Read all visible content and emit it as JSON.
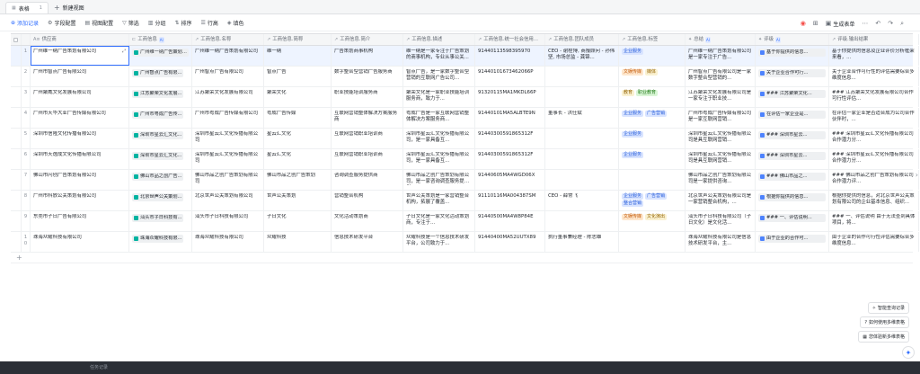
{
  "tabs": [
    {
      "label": "表格",
      "count": "1",
      "active": true
    },
    {
      "label": "新建视图",
      "active": false
    }
  ],
  "toolbar": {
    "add_record": "添加记录",
    "field_config": "字段配置",
    "view_config": "视图配置",
    "filter": "筛选",
    "group": "分组",
    "sort": "排序",
    "row_height": "行高",
    "fill_color": "填色",
    "generate_form": "生成表单"
  },
  "columns": [
    {
      "label": "供应商",
      "icon": "text-icon",
      "ai": false
    },
    {
      "label": "工商信息",
      "icon": "link-icon",
      "ai": true
    },
    {
      "label": "工商信息.名称",
      "icon": "lookup-icon",
      "ai": false
    },
    {
      "label": "工商信息.简称",
      "icon": "lookup-icon",
      "ai": false
    },
    {
      "label": "工商信息.简介",
      "icon": "lookup-icon",
      "ai": false
    },
    {
      "label": "工商信息.描述",
      "icon": "lookup-icon",
      "ai": false
    },
    {
      "label": "工商信息.统一社会信用...",
      "icon": "lookup-icon",
      "ai": false
    },
    {
      "label": "工商信息.团队成员",
      "icon": "lookup-icon",
      "ai": false
    },
    {
      "label": "工商信息.标签",
      "icon": "lookup-icon",
      "ai": false
    },
    {
      "label": "总结",
      "icon": "ai-icon",
      "ai": true
    },
    {
      "label": "评级",
      "icon": "ai-icon",
      "ai": true
    },
    {
      "label": "评级.输出结果",
      "icon": "lookup-icon",
      "ai": false
    }
  ],
  "rows": [
    {
      "num": "1",
      "supplier": "广州维一纳广告策划有限公司",
      "biz": "广州维一纳广告策划有...",
      "name": "广州维一纳广告策划有限公司",
      "short": "维一纳",
      "intro": "广告策划商事机构",
      "desc": "维一纳是一家专注于广告策划的商事机构，专业从事公关...",
      "credit": "91440113598395970",
      "team": "CEO - 谢程博, 商报顾问 - 孙伟坚, 市场总监 - 龚锦...",
      "tags": [
        {
          "t": "企业服务",
          "c": "blue"
        }
      ],
      "summary": "广州维一纳广告策划有限公司是一家专注于广告...",
      "rating": "基于你提供的信息...",
      "result": "基于你提供的信息及企业评价分析框架来看，..."
    },
    {
      "num": "2",
      "supplier": "广州市智点广告有限公司",
      "biz": "广州智点广告有限...",
      "name": "广州智点广告有限公司",
      "short": "智点广告",
      "intro": "数字整合型营销广告服务商",
      "desc": "智点广告，是一家数字整合型营销的互联网广告公司...",
      "credit": "91440101673462066P",
      "team": "",
      "tags": [
        {
          "t": "文娱传媒",
          "c": "orange"
        },
        {
          "t": "媒体",
          "c": "yellow"
        }
      ],
      "summary": "广州智点广告有限公司是一家数字整合型营销的...",
      "rating": "关于企业合作可行...",
      "result": "关于企业合作可行性的评估需要综合多维度信息..."
    },
    {
      "num": "3",
      "supplier": "广州聚威文化发展有限公司",
      "biz": "江苏聚荣文化发展...",
      "name": "江苏聚荣文化发展有限公司",
      "short": "聚荣文化",
      "intro": "职业技能培训服务商",
      "desc": "聚荣文化是一家职业技能培训服务商，致力于...",
      "credit": "91320115MA1MKDL66P",
      "team": "",
      "tags": [
        {
          "t": "教育",
          "c": "yellow"
        },
        {
          "t": "职业教育",
          "c": "green"
        }
      ],
      "summary": "江苏聚荣文化发展有限公司是一家专注于职业技...",
      "rating": "### 江苏聚荣文化...",
      "result": "### 江苏聚荣文化发展有限公司合作可行性评估..."
    },
    {
      "num": "4",
      "supplier": "广州市天华大业广告传媒有限公司",
      "biz": "广州市粤成广告传...",
      "name": "广州市粤成广告传媒有限公司",
      "short": "粤成广告传媒",
      "intro": "互联网营销整体解决方案服务商",
      "desc": "粤成广告是一家互联网营销整体解决方案服务商...",
      "credit": "91440101MA5ALBTE9N",
      "team": "董事长 - 洪仕斌",
      "tags": [
        {
          "t": "企业服务",
          "c": "blue"
        },
        {
          "t": "广告营销",
          "c": "blue"
        }
      ],
      "summary": "广州市粤成广告传媒有限公司是一家互联网营销...",
      "rating": "在评估一家企业是...",
      "result": "在评估一家企业是否适合成为公司合作伙伴时，..."
    },
    {
      "num": "5",
      "supplier": "深圳市信隆文化传播有限公司",
      "biz": "深圳市星云汇文化...",
      "name": "深圳市星云汇文化传播有限公司",
      "short": "星云汇文化",
      "intro": "互联网营销职业培训商",
      "desc": "深圳市星云汇文化传播有限公司，是一家具备互...",
      "credit": "91440300591865312F",
      "team": "",
      "tags": [
        {
          "t": "企业服务",
          "c": "blue"
        }
      ],
      "summary": "深圳市星云汇文化传播有限公司是具互联网营销...",
      "rating": "### 深圳市星云...",
      "result": "### 深圳市星云汇文化传播有限公司合作潜力分..."
    },
    {
      "num": "6",
      "supplier": "深圳市天逸成文化传播有限公司",
      "biz": "深圳市星云汇文化...",
      "name": "深圳市星云汇文化传播有限公司",
      "short": "星云汇文化",
      "intro": "互联网营销职业培训商",
      "desc": "深圳市星云汇文化传播有限公司，是一家具备互...",
      "credit": "91440300591865312F",
      "team": "",
      "tags": [
        {
          "t": "企业服务",
          "c": "blue"
        }
      ],
      "summary": "深圳市星云汇文化传播有限公司是具互联网营销...",
      "rating": "### 深圳市星云...",
      "result": "### 深圳市星云汇文化传播有限公司合作潜力分..."
    },
    {
      "num": "7",
      "supplier": "佛山市闪创广告策划有限公司",
      "biz": "佛山市品之创广告...",
      "name": "佛山市品之创广告策划有限公司",
      "short": "佛山市品之创广告策划",
      "intro": "咨询调查服务提供商",
      "desc": "佛山市品之创广告策划有限公司，是一家咨询调查服务提供...",
      "credit": "91440605MA4WGD06X",
      "team": "",
      "tags": [],
      "summary": "佛山市品之创广告策划有限公司是一家提供咨询...",
      "rating": "### 佛山市品之...",
      "result": "### 佛山市品之创广告策划有限公司合作潜力评..."
    },
    {
      "num": "8",
      "supplier": "广州市科放公关策划有限公司",
      "biz": "北京世声公关策划...",
      "name": "北京世声公关策划有限公司",
      "short": "世声公关策划",
      "intro": "营销整合机构",
      "desc": "世声公关策划是一家营销整合机构，拓展了覆盖...",
      "credit": "91110116MA004387SM",
      "team": "CEO - 薛常飞",
      "tags": [
        {
          "t": "企业服务",
          "c": "blue"
        },
        {
          "t": "广告营销",
          "c": "blue"
        },
        {
          "t": "整合营销",
          "c": "blue"
        }
      ],
      "summary": "北京世声公关策划有限公司是一家营销整合机构，...",
      "rating": "根据你提供的信息...",
      "result": "根据你提供的信息，对北京世声公关策划有限公司的企业基本信息、组织..."
    },
    {
      "num": "9",
      "supplier": "东莞市子日广告有限公司",
      "biz": "汕头市子日科技有...",
      "name": "汕头市子日科技有限公司",
      "short": "子日文化",
      "intro": "文化活动策划商",
      "desc": "子日文化是一家文化活动策划商，专注于...",
      "credit": "91440500MA4W8P84E",
      "team": "",
      "tags": [
        {
          "t": "文娱传媒",
          "c": "orange"
        },
        {
          "t": "文化演出",
          "c": "yellow"
        }
      ],
      "summary": "汕头市子日科技有限公司（子日文化）是文化活...",
      "rating": "### 一、评估说明...",
      "result": "### 一、评估说明 由于无法查到具体项目，将..."
    },
    {
      "num": "10",
      "supplier": "珠海众耀科技有限公司",
      "biz": "珠海众耀科技有限...",
      "name": "珠海众耀科技有限公司",
      "short": "众耀科技",
      "intro": "信息技术研发平台",
      "desc": "众耀科技是一个信息技术研发平台，公司致力于...",
      "credit": "91440400MA52UUTX89",
      "team": "执行董事兼经理 - 陈志雄",
      "tags": [],
      "summary": "珠海众耀科技有限公司是信息技术研发平台，主...",
      "rating": "由于企业的合作可...",
      "result": "由于企业的合作可行性评估需要综合多维度信息..."
    }
  ],
  "float_actions": {
    "smart_fill": "智能查询记录",
    "how_to_multi": "如何使用多维表格",
    "templates": "您体验新多维表格"
  },
  "bottom": {
    "text": "任务记录"
  },
  "colors": {
    "accent": "#3370ff"
  }
}
